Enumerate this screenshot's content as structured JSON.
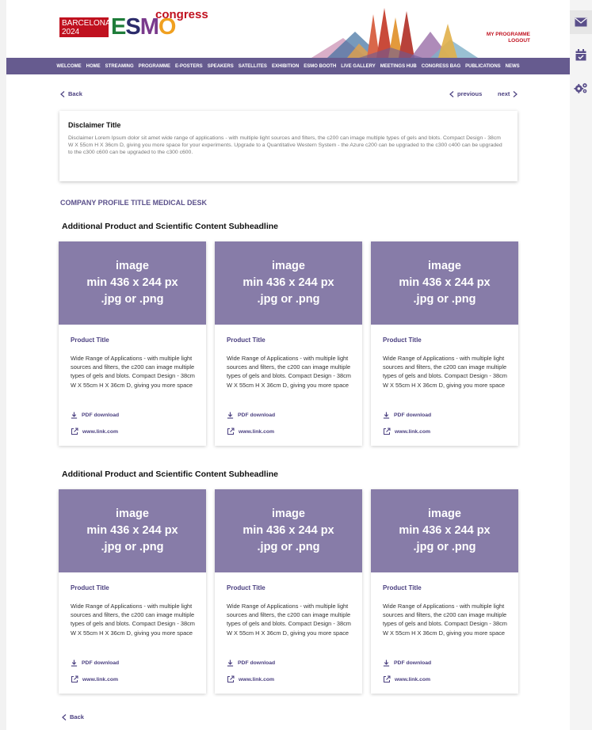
{
  "header": {
    "logo_city": "BARCELONA",
    "logo_year": "2024",
    "logo_esmo": [
      "E",
      "S",
      "M",
      "O"
    ],
    "logo_congress": "congress",
    "my_programme": "MY PROGRAMME",
    "logout": "LOGOUT"
  },
  "nav": [
    "WELCOME",
    "HOME",
    "STREAMING",
    "PROGRAMME",
    "E-POSTERS",
    "SPEAKERS",
    "SATELLITES",
    "EXHIBITION",
    "ESMO BOOTH",
    "LIVE GALLERY",
    "MEETINGS HUB",
    "CONGRESS BAG",
    "PUBLICATIONS",
    "NEWS"
  ],
  "pager": {
    "back": "Back",
    "previous": "previous",
    "next": "next"
  },
  "disclaimer": {
    "title": "Disclaimer Title",
    "text": "Disclaimer Lorem Ipsum dolor sit amet wide range of applications - with multiple light sources and filters, the c200 can image multiple types of gels and blots. Compact Design - 38cm W X 55cm H X 36cm D, giving you more space for your experiments. Upgrade to a Quantitative Western System - the Azure c200 can be upgraded to the c300 c400 can be upgraded to the c300 c600 can be upgraded to the c300 c600."
  },
  "company_title": "COMPANY PROFILE TITLE MEDICAL DESK",
  "sections": [
    {
      "subheadline": "Additional Product and Scientific Content Subheadline",
      "cards": [
        {
          "img_lines": [
            "image",
            "min 436 x 244 px",
            ".jpg or .png"
          ],
          "title": "Product Title",
          "desc": "Wide Range of Applications - with multiple light sources and filters, the c200 can image multiple types of gels and blots. Compact Design - 38cm W X 55cm H X 36cm D, giving you more space for your",
          "pdf": "PDF download",
          "link": "www.link.com"
        },
        {
          "img_lines": [
            "image",
            "min 436 x 244 px",
            ".jpg or .png"
          ],
          "title": "Product Title",
          "desc": "Wide Range of Applications - with multiple light sources and filters, the c200 can image multiple types of gels and blots. Compact Design - 38cm W X 55cm H X 36cm D, giving you more space for your",
          "pdf": "PDF download",
          "link": "www.link.com"
        },
        {
          "img_lines": [
            "image",
            "min 436 x 244 px",
            ".jpg or .png"
          ],
          "title": "Product Title",
          "desc": "Wide Range of Applications - with multiple light sources and filters, the c200 can image multiple types of gels and blots. Compact Design - 38cm W X 55cm H X 36cm D, giving you more space for your",
          "pdf": "PDF download",
          "link": "www.link.com"
        }
      ]
    },
    {
      "subheadline": "Additional Product and Scientific Content Subheadline",
      "cards": [
        {
          "img_lines": [
            "image",
            "min 436 x 244 px",
            ".jpg or .png"
          ],
          "title": "Product Title",
          "desc": "Wide Range of Applications - with multiple light sources and filters, the c200 can image multiple types of gels and blots. Compact Design - 38cm W X 55cm H X 36cm D, giving you more space for your",
          "pdf": "PDF download",
          "link": "www.link.com"
        },
        {
          "img_lines": [
            "image",
            "min 436 x 244 px",
            ".jpg or .png"
          ],
          "title": "Product Title",
          "desc": "Wide Range of Applications - with multiple light sources and filters, the c200 can image multiple types of gels and blots. Compact Design - 38cm W X 55cm H X 36cm D, giving you more space for your",
          "pdf": "PDF download",
          "link": "www.link.com"
        },
        {
          "img_lines": [
            "image",
            "min 436 x 244 px",
            ".jpg or .png"
          ],
          "title": "Product Title",
          "desc": "Wide Range of Applications - with multiple light sources and filters, the c200 can image multiple types of gels and blots. Compact Design - 38cm W X 55cm H X 36cm D, giving you more space for your",
          "pdf": "PDF download",
          "link": "www.link.com"
        }
      ]
    }
  ],
  "colors": {
    "nav": "#665b8f",
    "accent": "#4b4080",
    "image_placeholder": "#877ca8",
    "brand_red": "#c0111f"
  },
  "icons": [
    "mail-icon",
    "calendar-check-icon",
    "settings-gears-icon",
    "download-icon",
    "external-link-icon",
    "chevron-left-icon",
    "chevron-right-icon"
  ]
}
